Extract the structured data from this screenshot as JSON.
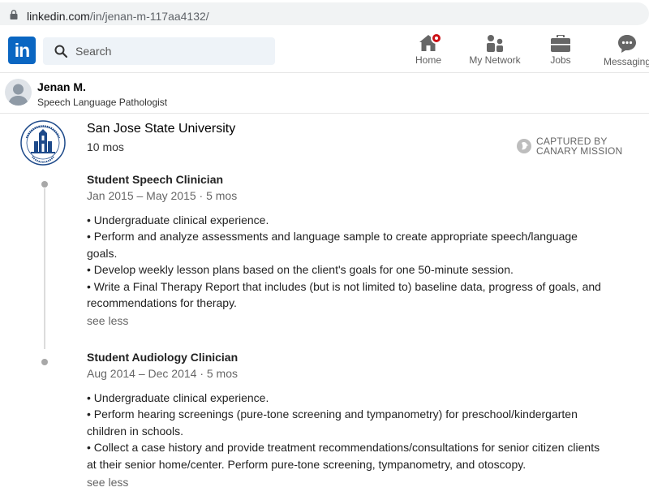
{
  "browser": {
    "url_domain": "linkedin.com",
    "url_path": "/in/jenan-m-117aa4132/",
    "lock_icon": "lock-icon"
  },
  "nav": {
    "logo_text": "in",
    "search_placeholder": "Search",
    "items": [
      {
        "label": "Home",
        "icon": "home-icon"
      },
      {
        "label": "My Network",
        "icon": "network-icon"
      },
      {
        "label": "Jobs",
        "icon": "briefcase-icon"
      },
      {
        "label": "Messaging",
        "icon": "chat-icon"
      }
    ],
    "accent": "#0a66c2",
    "notification_color": "#cc1016"
  },
  "profile": {
    "name": "Jenan M.",
    "headline": "Speech Language Pathologist"
  },
  "experience": {
    "organization": "San Jose State University",
    "duration": "10 mos",
    "watermark_line1": "CAPTURED BY",
    "watermark_line2": "CANARY MISSION",
    "roles": [
      {
        "title": "Student Speech Clinician",
        "dates": "Jan 2015 – May 2015 · 5 mos",
        "bullets": [
          "• Undergraduate clinical experience.",
          "• Perform and analyze assessments and language sample to create appropriate speech/language goals.",
          "• Develop weekly lesson plans based on the client's goals for one 50-minute session.",
          "• Write a Final Therapy Report that includes (but is not limited to) baseline data, progress of goals, and recommendations for therapy."
        ],
        "toggle": "see less"
      },
      {
        "title": "Student Audiology Clinician",
        "dates": "Aug 2014 – Dec 2014 · 5 mos",
        "bullets": [
          "• Undergraduate clinical experience.",
          "• Perform hearing screenings (pure-tone screening and tympanometry) for preschool/kindergarten children in schools.",
          "• Collect a case history and provide treatment recommendations/consultations for senior citizen clients at their senior home/center. Perform pure-tone screening, tympanometry, and otoscopy."
        ],
        "toggle": "see less"
      }
    ]
  }
}
